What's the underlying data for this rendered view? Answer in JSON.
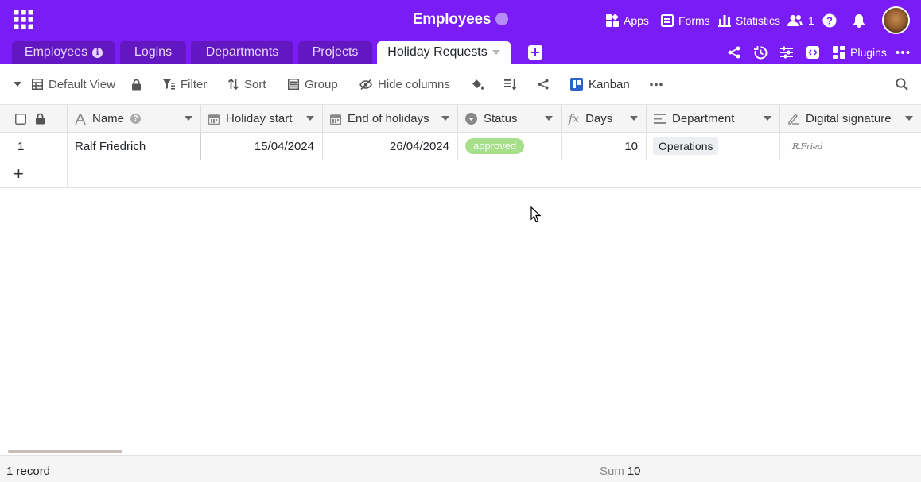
{
  "header": {
    "base_title": "Employees",
    "apps": "Apps",
    "forms": "Forms",
    "statistics": "Statistics",
    "collaborators_count": "1",
    "plugins": "Plugins"
  },
  "tabs": [
    {
      "label": "Employees",
      "active": false,
      "info": "i"
    },
    {
      "label": "Logins",
      "active": false
    },
    {
      "label": "Departments",
      "active": false
    },
    {
      "label": "Projects",
      "active": false
    },
    {
      "label": "Holiday Requests",
      "active": true
    }
  ],
  "toolbar": {
    "view_name": "Default View",
    "filter": "Filter",
    "sort": "Sort",
    "group": "Group",
    "hide_columns": "Hide columns",
    "kanban": "Kanban"
  },
  "columns": [
    {
      "name": "Name",
      "icon": "text-icon",
      "help": "?"
    },
    {
      "name": "Holiday start",
      "icon": "calendar-icon"
    },
    {
      "name": "End of holidays",
      "icon": "calendar-icon"
    },
    {
      "name": "Status",
      "icon": "single-select-icon"
    },
    {
      "name": "Days",
      "icon": "formula-icon"
    },
    {
      "name": "Department",
      "icon": "link-icon"
    },
    {
      "name": "Digital signature",
      "icon": "signature-icon"
    }
  ],
  "rows": [
    {
      "index": "1",
      "name": "Ralf Friedrich",
      "holiday_start": "15/04/2024",
      "end_of_holidays": "26/04/2024",
      "status": "approved",
      "days": "10",
      "department": "Operations",
      "signature": "R.Fried"
    }
  ],
  "add_row_symbol": "+",
  "footer": {
    "record_count": "1 record",
    "sum_label": "Sum",
    "sum_value": "10"
  },
  "colors": {
    "header": "#7a1cf6",
    "tab_inactive": "#6217c3",
    "status_approved": "#a6e08a"
  }
}
